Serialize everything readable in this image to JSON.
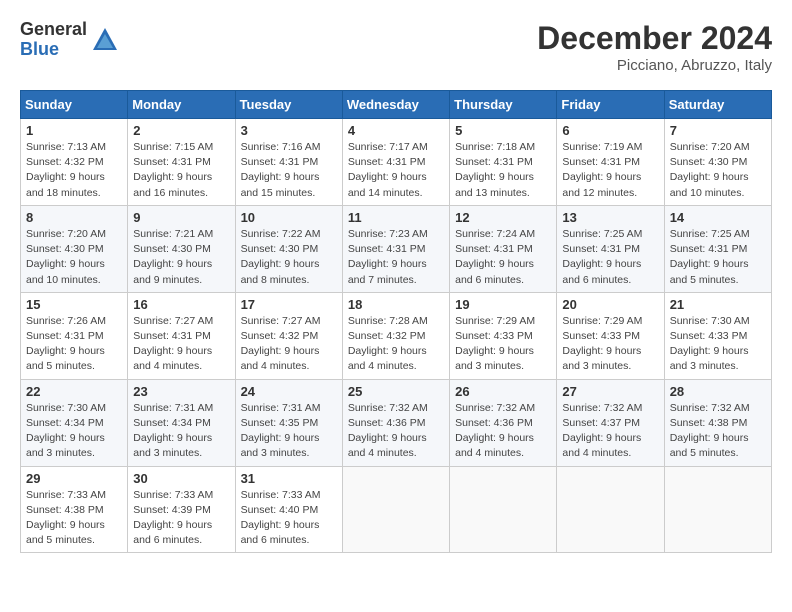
{
  "header": {
    "logo_general": "General",
    "logo_blue": "Blue",
    "month_title": "December 2024",
    "location": "Picciano, Abruzzo, Italy"
  },
  "calendar": {
    "days_of_week": [
      "Sunday",
      "Monday",
      "Tuesday",
      "Wednesday",
      "Thursday",
      "Friday",
      "Saturday"
    ],
    "weeks": [
      [
        {
          "day": "1",
          "info": "Sunrise: 7:13 AM\nSunset: 4:32 PM\nDaylight: 9 hours and 18 minutes."
        },
        {
          "day": "2",
          "info": "Sunrise: 7:15 AM\nSunset: 4:31 PM\nDaylight: 9 hours and 16 minutes."
        },
        {
          "day": "3",
          "info": "Sunrise: 7:16 AM\nSunset: 4:31 PM\nDaylight: 9 hours and 15 minutes."
        },
        {
          "day": "4",
          "info": "Sunrise: 7:17 AM\nSunset: 4:31 PM\nDaylight: 9 hours and 14 minutes."
        },
        {
          "day": "5",
          "info": "Sunrise: 7:18 AM\nSunset: 4:31 PM\nDaylight: 9 hours and 13 minutes."
        },
        {
          "day": "6",
          "info": "Sunrise: 7:19 AM\nSunset: 4:31 PM\nDaylight: 9 hours and 12 minutes."
        },
        {
          "day": "7",
          "info": "Sunrise: 7:20 AM\nSunset: 4:30 PM\nDaylight: 9 hours and 10 minutes."
        }
      ],
      [
        {
          "day": "8",
          "info": "Sunrise: 7:20 AM\nSunset: 4:30 PM\nDaylight: 9 hours and 10 minutes."
        },
        {
          "day": "9",
          "info": "Sunrise: 7:21 AM\nSunset: 4:30 PM\nDaylight: 9 hours and 9 minutes."
        },
        {
          "day": "10",
          "info": "Sunrise: 7:22 AM\nSunset: 4:30 PM\nDaylight: 9 hours and 8 minutes."
        },
        {
          "day": "11",
          "info": "Sunrise: 7:23 AM\nSunset: 4:31 PM\nDaylight: 9 hours and 7 minutes."
        },
        {
          "day": "12",
          "info": "Sunrise: 7:24 AM\nSunset: 4:31 PM\nDaylight: 9 hours and 6 minutes."
        },
        {
          "day": "13",
          "info": "Sunrise: 7:25 AM\nSunset: 4:31 PM\nDaylight: 9 hours and 6 minutes."
        },
        {
          "day": "14",
          "info": "Sunrise: 7:25 AM\nSunset: 4:31 PM\nDaylight: 9 hours and 5 minutes."
        }
      ],
      [
        {
          "day": "15",
          "info": "Sunrise: 7:26 AM\nSunset: 4:31 PM\nDaylight: 9 hours and 5 minutes."
        },
        {
          "day": "16",
          "info": "Sunrise: 7:27 AM\nSunset: 4:31 PM\nDaylight: 9 hours and 4 minutes."
        },
        {
          "day": "17",
          "info": "Sunrise: 7:27 AM\nSunset: 4:32 PM\nDaylight: 9 hours and 4 minutes."
        },
        {
          "day": "18",
          "info": "Sunrise: 7:28 AM\nSunset: 4:32 PM\nDaylight: 9 hours and 4 minutes."
        },
        {
          "day": "19",
          "info": "Sunrise: 7:29 AM\nSunset: 4:33 PM\nDaylight: 9 hours and 3 minutes."
        },
        {
          "day": "20",
          "info": "Sunrise: 7:29 AM\nSunset: 4:33 PM\nDaylight: 9 hours and 3 minutes."
        },
        {
          "day": "21",
          "info": "Sunrise: 7:30 AM\nSunset: 4:33 PM\nDaylight: 9 hours and 3 minutes."
        }
      ],
      [
        {
          "day": "22",
          "info": "Sunrise: 7:30 AM\nSunset: 4:34 PM\nDaylight: 9 hours and 3 minutes."
        },
        {
          "day": "23",
          "info": "Sunrise: 7:31 AM\nSunset: 4:34 PM\nDaylight: 9 hours and 3 minutes."
        },
        {
          "day": "24",
          "info": "Sunrise: 7:31 AM\nSunset: 4:35 PM\nDaylight: 9 hours and 3 minutes."
        },
        {
          "day": "25",
          "info": "Sunrise: 7:32 AM\nSunset: 4:36 PM\nDaylight: 9 hours and 4 minutes."
        },
        {
          "day": "26",
          "info": "Sunrise: 7:32 AM\nSunset: 4:36 PM\nDaylight: 9 hours and 4 minutes."
        },
        {
          "day": "27",
          "info": "Sunrise: 7:32 AM\nSunset: 4:37 PM\nDaylight: 9 hours and 4 minutes."
        },
        {
          "day": "28",
          "info": "Sunrise: 7:32 AM\nSunset: 4:38 PM\nDaylight: 9 hours and 5 minutes."
        }
      ],
      [
        {
          "day": "29",
          "info": "Sunrise: 7:33 AM\nSunset: 4:38 PM\nDaylight: 9 hours and 5 minutes."
        },
        {
          "day": "30",
          "info": "Sunrise: 7:33 AM\nSunset: 4:39 PM\nDaylight: 9 hours and 6 minutes."
        },
        {
          "day": "31",
          "info": "Sunrise: 7:33 AM\nSunset: 4:40 PM\nDaylight: 9 hours and 6 minutes."
        },
        {
          "day": "",
          "info": ""
        },
        {
          "day": "",
          "info": ""
        },
        {
          "day": "",
          "info": ""
        },
        {
          "day": "",
          "info": ""
        }
      ]
    ]
  }
}
